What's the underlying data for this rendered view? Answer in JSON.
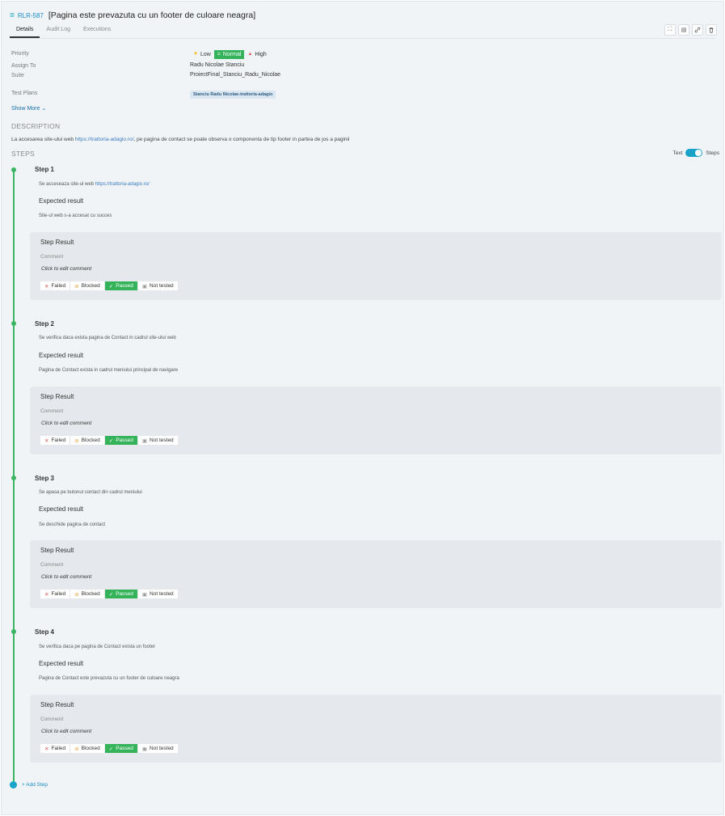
{
  "header": {
    "key": "RLR-587",
    "title": "[Pagina este prevazuta cu un footer de culoare neagra]"
  },
  "tabs": [
    {
      "label": "Details"
    },
    {
      "label": "Audit Log"
    },
    {
      "label": "Executions"
    }
  ],
  "toolbar": {
    "icons": [
      "expand-icon",
      "document-icon",
      "link-icon",
      "delete-icon"
    ],
    "glyphs": [
      "⛶",
      "▤",
      "🔗",
      "🗑"
    ]
  },
  "fields": {
    "priority": {
      "label": "Priority",
      "options": [
        "Low",
        "Normal",
        "High"
      ],
      "selected": "Normal"
    },
    "assign_to": {
      "label": "Assign To",
      "value": "Radu Nicolae Stanciu"
    },
    "suite": {
      "label": "Suite",
      "value": "ProiectFinal_Stanciu_Radu_Nicolae"
    },
    "test_plans": {
      "label": "Test Plans",
      "value": "Stanciu Radu Nicolae-trattoria-adagio"
    },
    "show_more": "Show More"
  },
  "description": {
    "heading": "DESCRIPTION",
    "before": "La accesarea site-ului web ",
    "link": "https://trattoria-adagio.ro/",
    "after": ", pe pagina de contact se poate observa o componenta de tip footer in partea de jos a paginii"
  },
  "steps_section": {
    "heading": "STEPS",
    "toggle_left": "Text",
    "toggle_right": "Steps"
  },
  "result_labels": {
    "title": "Step Result",
    "comment": "Comment",
    "edit": "Click to edit comment",
    "failed": "Failed",
    "blocked": "Blocked",
    "passed": "Passed",
    "not_tested": "Not tested"
  },
  "steps": [
    {
      "title": "Step 1",
      "action_prefix": "Se acceseaza site-ul web ",
      "action_link": "https://trattoria-adagio.ro/",
      "expected_label": "Expected result",
      "expected": "Site-ul web s-a accesat cu succes",
      "result": "Passed"
    },
    {
      "title": "Step 2",
      "action_prefix": "Se verifica daca exista pagina de Contact in cadrul site-ului web",
      "action_link": "",
      "expected_label": "Expected result",
      "expected": "Pagina de Contact exista in cadrul meniului principal de navigare",
      "result": "Passed"
    },
    {
      "title": "Step 3",
      "action_prefix": "Se apasa pe butonul contact din cadrul meniului",
      "action_link": "",
      "expected_label": "Expected result",
      "expected": "Se deschide pagina de contact",
      "result": "Passed"
    },
    {
      "title": "Step 4",
      "action_prefix": "Se verifica daca pe pagina de Contact exista un footer",
      "action_link": "",
      "expected_label": "Expected result",
      "expected": "Pagina de Contact este prevazuta cu un footer de culoare neagra",
      "result": "Passed"
    }
  ],
  "add_step": "+ Add Step",
  "colors": {
    "accent": "#1aa3c8",
    "passed": "#34b35a",
    "timeline": "#39b563"
  }
}
